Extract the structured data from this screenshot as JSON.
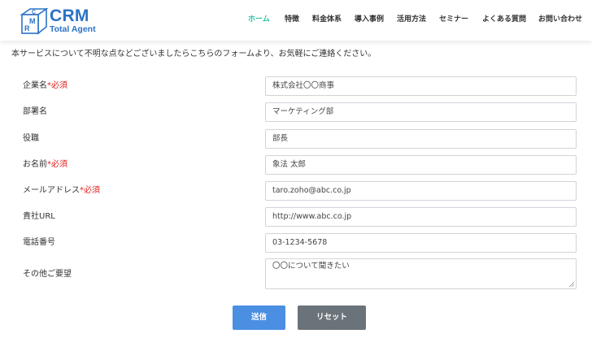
{
  "logo": {
    "badge_letters": [
      "C",
      "R",
      "M"
    ],
    "title": "CRM",
    "subtitle": "Total Agent",
    "color": "#2b72c6"
  },
  "nav": {
    "active_color": "#2ec4a6",
    "items": [
      "ホーム",
      "特徴",
      "料金体系",
      "導入事例",
      "活用方法",
      "セミナー",
      "よくある質問",
      "お問い合わせ"
    ]
  },
  "intro": "本サービスについて不明な点などございましたらこちらのフォームより、お気軽にご連絡ください。",
  "form": {
    "required_mark": "*必須",
    "fields": [
      {
        "label": "企業名",
        "required": true,
        "value": "株式会社〇〇商事"
      },
      {
        "label": "部署名",
        "required": false,
        "value": "マーケティング部"
      },
      {
        "label": "役職",
        "required": false,
        "value": "部長"
      },
      {
        "label": "お名前",
        "required": true,
        "value": "象法 太郎"
      },
      {
        "label": "メールアドレス",
        "required": true,
        "value": "taro.zoho@abc.co.jp"
      },
      {
        "label": "貴社URL",
        "required": false,
        "value": "http://www.abc.co.jp"
      },
      {
        "label": "電話番号",
        "required": false,
        "value": "03-1234-5678"
      },
      {
        "label": "その他ご要望",
        "required": false,
        "value": "〇〇について聞きたい"
      }
    ],
    "submit_label": "送信",
    "reset_label": "リセット",
    "colors": {
      "required": "#e02020",
      "submit": "#4b8fe2",
      "reset": "#6b737a"
    }
  }
}
